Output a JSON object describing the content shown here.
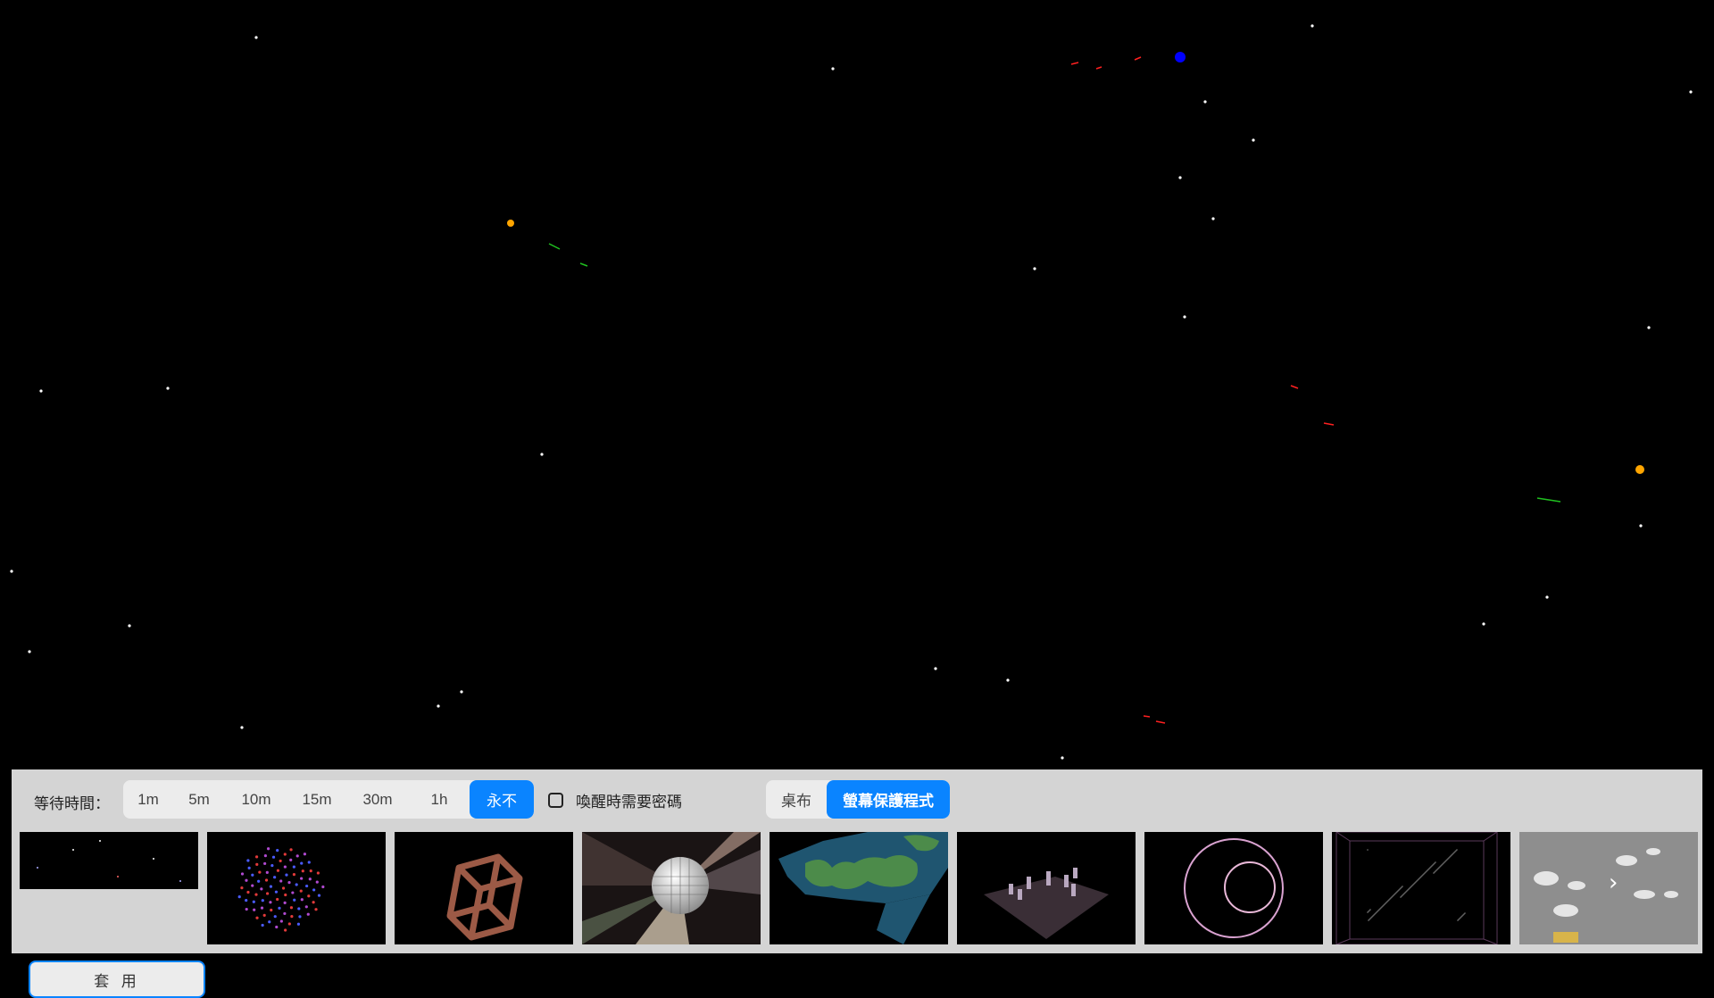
{
  "toolbar": {
    "wait_label": "等待時間：",
    "wait_options": [
      "1m",
      "5m",
      "10m",
      "15m",
      "30m",
      "1h",
      "永不"
    ],
    "wait_selected": "永不",
    "require_password_label": "喚醒時需要密碼",
    "require_password_checked": false,
    "mode_tabs": [
      "桌布",
      "螢幕保護程式"
    ],
    "mode_selected": "螢幕保護程式"
  },
  "apply_label": "套 用",
  "thumbnails": [
    {
      "name": "starfield-thumb"
    },
    {
      "name": "particle-sphere-thumb"
    },
    {
      "name": "wireframe-cube-thumb"
    },
    {
      "name": "disco-ball-thumb"
    },
    {
      "name": "world-map-thumb"
    },
    {
      "name": "chess-board-thumb"
    },
    {
      "name": "spiral-rings-thumb"
    },
    {
      "name": "particle-box-thumb"
    },
    {
      "name": "flying-objects-thumb",
      "arrow": "›"
    }
  ],
  "colors": {
    "accent": "#0a84ff",
    "panel_bg": "#d4d4d4",
    "segment_bg": "#ececec",
    "background": "#000000"
  }
}
